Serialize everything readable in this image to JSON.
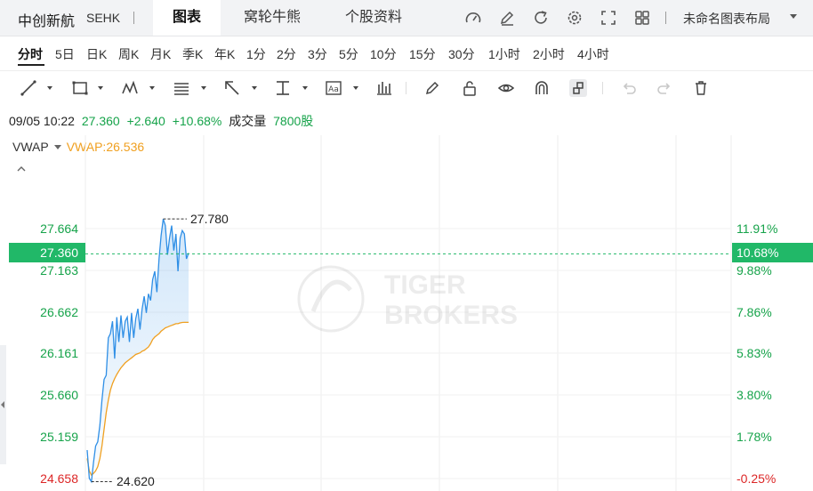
{
  "header": {
    "stock_name": "中创新航",
    "exchange": "SEHK",
    "tabs": [
      {
        "label": "图表",
        "active": true
      },
      {
        "label": "窝轮牛熊",
        "active": false
      },
      {
        "label": "个股资料",
        "active": false
      }
    ],
    "icons": [
      "gauge-icon",
      "edit-icon",
      "refresh-icon",
      "settings-icon",
      "fullscreen-icon",
      "grid-icon"
    ],
    "layout_label": "未命名图表布局"
  },
  "periods": [
    {
      "label": "分时",
      "active": true
    },
    {
      "label": "5日"
    },
    {
      "label": "日K"
    },
    {
      "label": "周K"
    },
    {
      "label": "月K"
    },
    {
      "label": "季K"
    },
    {
      "label": "年K"
    },
    {
      "label": "1分"
    },
    {
      "label": "2分"
    },
    {
      "label": "3分"
    },
    {
      "label": "5分"
    },
    {
      "label": "10分"
    },
    {
      "label": "15分"
    },
    {
      "label": "30分"
    },
    {
      "label": "1小时"
    },
    {
      "label": "2小时"
    },
    {
      "label": "4小时"
    }
  ],
  "toolbar": {
    "tools": [
      "line-tool-icon",
      "rectangle-tool-icon",
      "pattern-tool-icon",
      "fibonacci-tool-icon",
      "arrow-tool-icon",
      "measure-tool-icon",
      "text-tool-icon",
      "indicator-icon",
      "brush-icon",
      "lock-icon",
      "eye-icon",
      "magnet-icon",
      "link-icon",
      "undo-icon",
      "redo-icon",
      "delete-icon"
    ]
  },
  "quote": {
    "datetime": "09/05 10:22",
    "price": "27.360",
    "change": "+2.640",
    "change_pct": "+10.68%",
    "volume_label": "成交量",
    "volume": "7800股"
  },
  "indicator": {
    "name": "VWAP",
    "value_label": "VWAP:26.536"
  },
  "colors": {
    "up": "#16a34a",
    "down": "#dc2626",
    "price_line": "#2f8fe6",
    "vwap_line": "#f0a020",
    "current_tag": "#21b868"
  },
  "watermark": "TIGER BROKERS",
  "chart_data": {
    "type": "line",
    "x_labels": [],
    "y_left_ticks": [
      "27.664",
      "27.163",
      "26.662",
      "26.161",
      "25.660",
      "25.159",
      "24.658"
    ],
    "y_right_ticks": [
      "11.91%",
      "9.88%",
      "7.86%",
      "5.83%",
      "3.80%",
      "1.78%",
      "-0.25%"
    ],
    "ylim": [
      24.658,
      27.78
    ],
    "current_price": "27.360",
    "current_pct": "10.68%",
    "high_label": "27.780",
    "low_label": "24.620",
    "series": [
      {
        "name": "price",
        "values": [
          25.0,
          24.66,
          24.62,
          24.85,
          25.05,
          25.1,
          25.3,
          25.6,
          25.85,
          25.9,
          26.35,
          26.4,
          26.55,
          26.1,
          26.6,
          26.3,
          26.62,
          26.35,
          26.55,
          26.6,
          26.3,
          26.65,
          26.35,
          26.58,
          26.7,
          26.45,
          26.7,
          26.85,
          26.65,
          26.88,
          26.8,
          27.05,
          27.15,
          26.9,
          27.3,
          27.58,
          27.78,
          27.7,
          27.35,
          27.55,
          27.7,
          27.4,
          27.6,
          27.15,
          27.55,
          27.64,
          27.6,
          27.3,
          27.37
        ]
      },
      {
        "name": "VWAP",
        "values": [
          24.9,
          24.75,
          24.7,
          24.72,
          24.75,
          24.8,
          24.9,
          25.05,
          25.25,
          25.45,
          25.6,
          25.72,
          25.8,
          25.86,
          25.91,
          25.95,
          25.99,
          26.02,
          26.05,
          26.07,
          26.09,
          26.11,
          26.13,
          26.15,
          26.16,
          26.17,
          26.19,
          26.2,
          26.22,
          26.24,
          26.28,
          26.33,
          26.36,
          26.38,
          26.4,
          26.43,
          26.45,
          26.47,
          26.48,
          26.49,
          26.5,
          26.51,
          26.52,
          26.52,
          26.53,
          26.535,
          26.536,
          26.536,
          26.536
        ]
      }
    ],
    "grid": true
  }
}
